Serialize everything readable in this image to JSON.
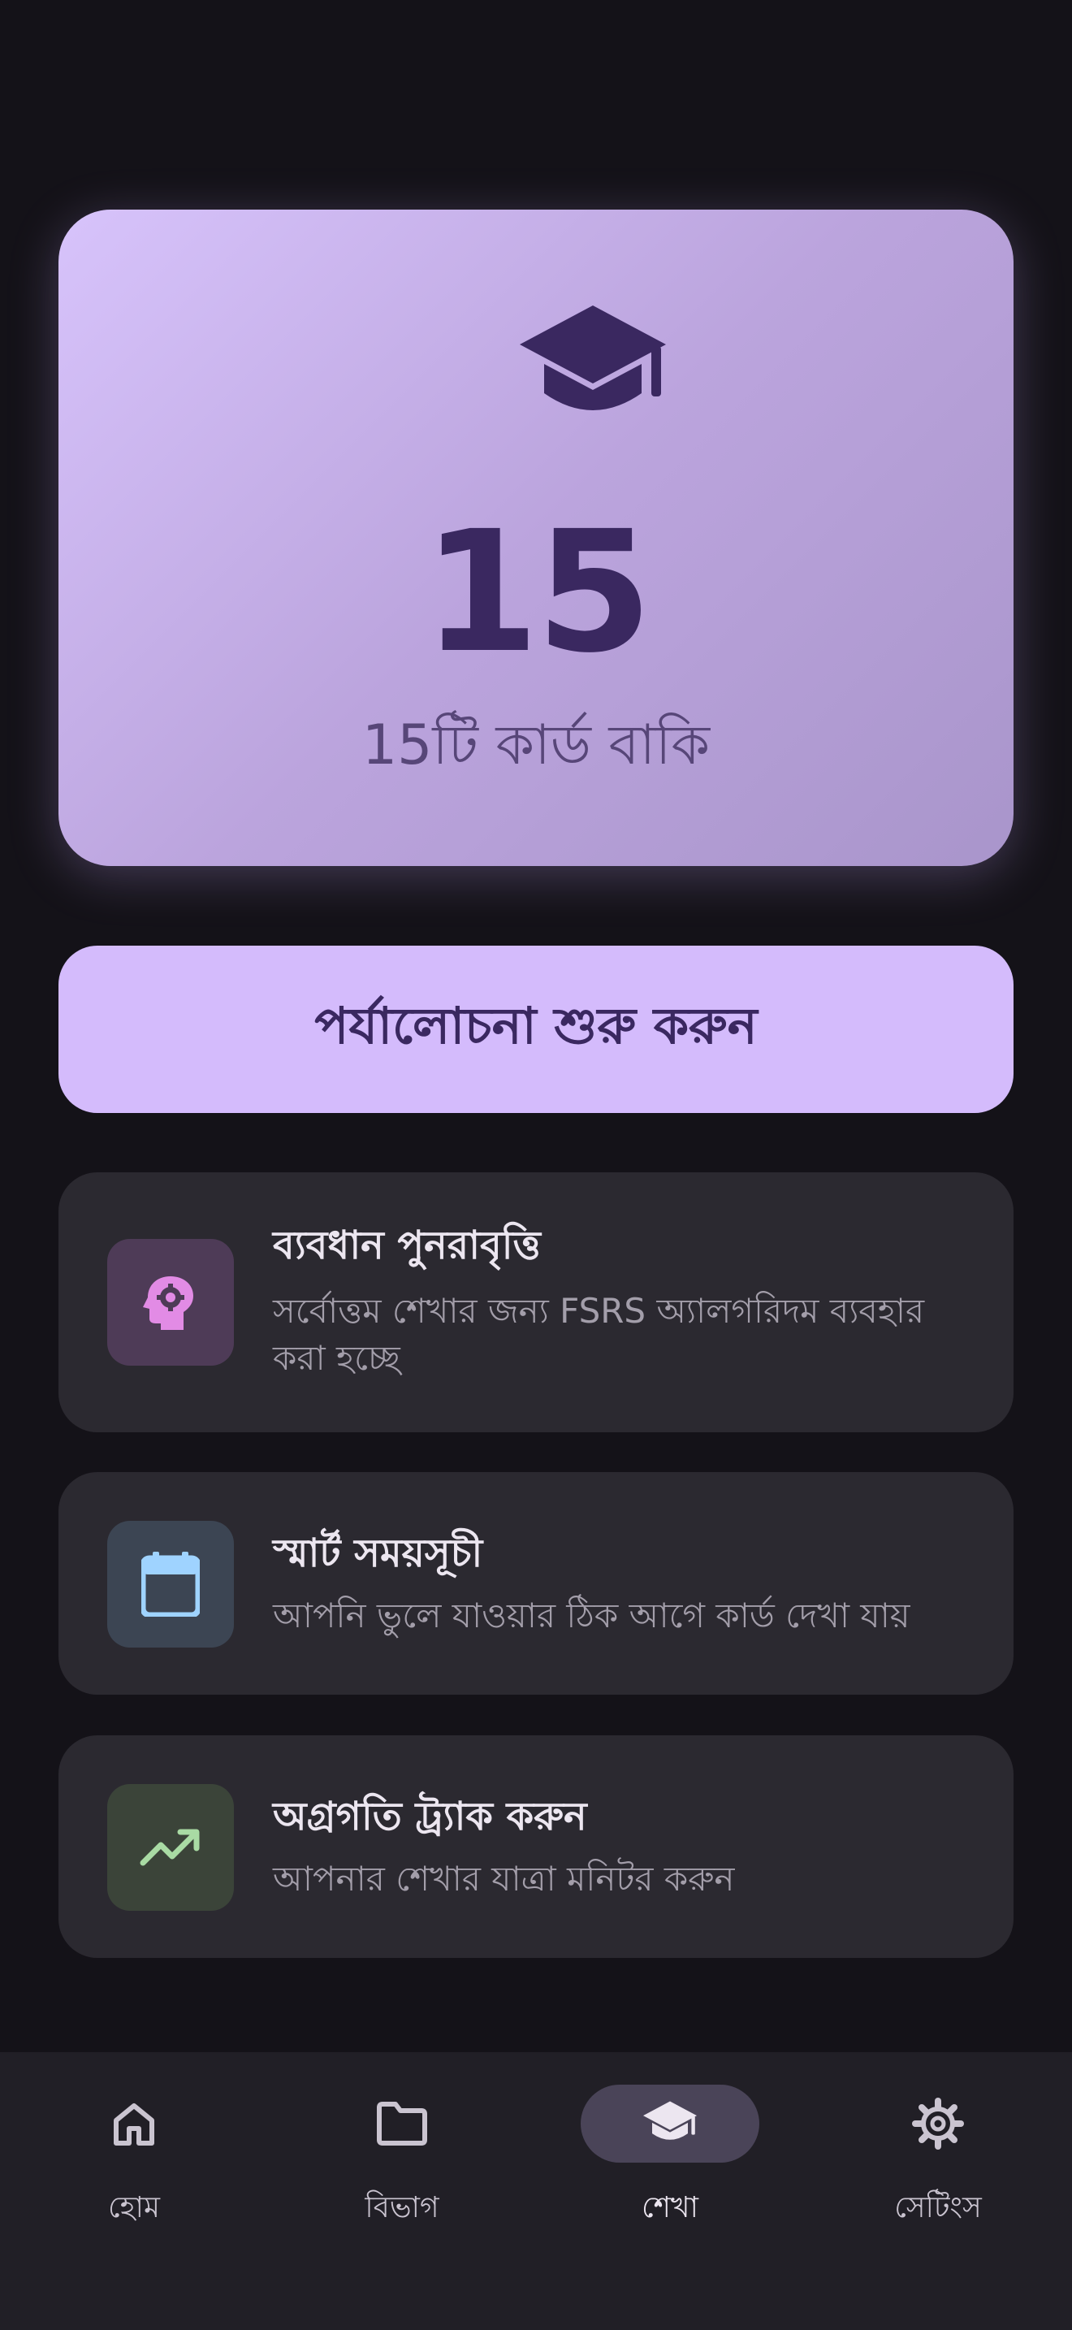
{
  "summary": {
    "count": "15",
    "subtitle": "15টি কার্ড বাকি",
    "icon": "graduation-cap-icon"
  },
  "start_review": {
    "label": "পর্যালোচনা শুরু করুন"
  },
  "features": [
    {
      "title": "ব্যবধান পুনরাবৃত্তি",
      "description": "সর্বোত্তম শেখার জন্য FSRS অ্যালগরিদম ব্যবহার করা হচ্ছে",
      "icon": "brain-gear-icon",
      "color": "#e28be5"
    },
    {
      "title": "স্মার্ট সময়সূচী",
      "description": "আপনি ভুলে যাওয়ার ঠিক আগে কার্ড দেখা যায়",
      "icon": "calendar-icon",
      "color": "#9fd3ff"
    },
    {
      "title": "অগ্রগতি ট্র্যাক করুন",
      "description": "আপনার শেখার যাত্রা মনিটর করুন",
      "icon": "trending-up-icon",
      "color": "#a9dba4"
    }
  ],
  "nav": [
    {
      "label": "হোম",
      "icon": "home-icon"
    },
    {
      "label": "বিভাগ",
      "icon": "folder-icon"
    },
    {
      "label": "শেখা",
      "icon": "graduation-cap-icon",
      "active": true
    },
    {
      "label": "সেটিংস",
      "icon": "gear-icon"
    }
  ],
  "colors": {
    "background": "#141218",
    "hero_gradient_start": "#d7c3fb",
    "hero_gradient_end": "#a995cb",
    "primary_dark": "#3a2860",
    "button": "#d4bbfc",
    "card": "#2b2930",
    "navbar": "#211f26"
  }
}
